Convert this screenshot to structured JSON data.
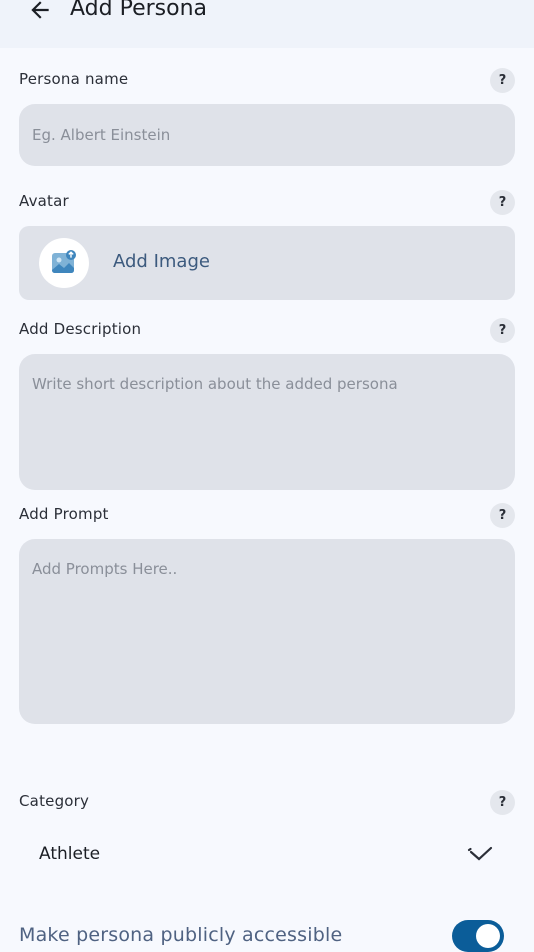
{
  "header": {
    "title": "Add Persona"
  },
  "persona_name": {
    "label": "Persona name",
    "placeholder": "Eg. Albert Einstein",
    "value": ""
  },
  "avatar": {
    "label": "Avatar",
    "button_label": "Add Image"
  },
  "description": {
    "label": "Add Description",
    "placeholder": "Write short description about the added persona",
    "value": ""
  },
  "prompt": {
    "label": "Add Prompt",
    "placeholder": "Add Prompts Here..",
    "value": ""
  },
  "category": {
    "label": "Category",
    "selected": "Athlete"
  },
  "public_toggle": {
    "label": "Make persona publicly accessible",
    "enabled": true
  },
  "help_symbol": "?",
  "colors": {
    "accent": "#0b5d99",
    "field_bg": "#dfe2e9",
    "page_bg": "#f7f9fe"
  }
}
